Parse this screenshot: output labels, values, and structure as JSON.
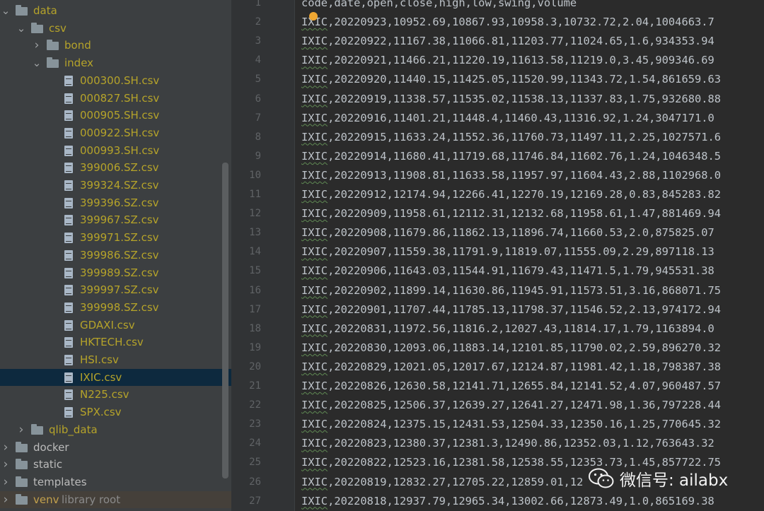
{
  "project_tree": [
    {
      "label": "data",
      "kind": "folder",
      "depth": 0,
      "expanded": true,
      "style": "yellow"
    },
    {
      "label": "csv",
      "kind": "folder",
      "depth": 1,
      "expanded": true,
      "style": "yellow"
    },
    {
      "label": "bond",
      "kind": "folder",
      "depth": 2,
      "expanded": false,
      "style": "yellow"
    },
    {
      "label": "index",
      "kind": "folder",
      "depth": 2,
      "expanded": true,
      "style": "yellow"
    },
    {
      "label": "000300.SH.csv",
      "kind": "file",
      "depth": 3,
      "style": "yellow"
    },
    {
      "label": "000827.SH.csv",
      "kind": "file",
      "depth": 3,
      "style": "yellow"
    },
    {
      "label": "000905.SH.csv",
      "kind": "file",
      "depth": 3,
      "style": "yellow"
    },
    {
      "label": "000922.SH.csv",
      "kind": "file",
      "depth": 3,
      "style": "yellow"
    },
    {
      "label": "000993.SH.csv",
      "kind": "file",
      "depth": 3,
      "style": "yellow"
    },
    {
      "label": "399006.SZ.csv",
      "kind": "file",
      "depth": 3,
      "style": "yellow"
    },
    {
      "label": "399324.SZ.csv",
      "kind": "file",
      "depth": 3,
      "style": "yellow"
    },
    {
      "label": "399396.SZ.csv",
      "kind": "file",
      "depth": 3,
      "style": "yellow"
    },
    {
      "label": "399967.SZ.csv",
      "kind": "file",
      "depth": 3,
      "style": "yellow"
    },
    {
      "label": "399971.SZ.csv",
      "kind": "file",
      "depth": 3,
      "style": "yellow"
    },
    {
      "label": "399986.SZ.csv",
      "kind": "file",
      "depth": 3,
      "style": "yellow"
    },
    {
      "label": "399989.SZ.csv",
      "kind": "file",
      "depth": 3,
      "style": "yellow"
    },
    {
      "label": "399997.SZ.csv",
      "kind": "file",
      "depth": 3,
      "style": "yellow"
    },
    {
      "label": "399998.SZ.csv",
      "kind": "file",
      "depth": 3,
      "style": "yellow"
    },
    {
      "label": "GDAXI.csv",
      "kind": "file",
      "depth": 3,
      "style": "yellow"
    },
    {
      "label": "HKTECH.csv",
      "kind": "file",
      "depth": 3,
      "style": "yellow"
    },
    {
      "label": "HSI.csv",
      "kind": "file",
      "depth": 3,
      "style": "yellow"
    },
    {
      "label": "IXIC.csv",
      "kind": "file",
      "depth": 3,
      "style": "yellow",
      "selected": true
    },
    {
      "label": "N225.csv",
      "kind": "file",
      "depth": 3,
      "style": "yellow"
    },
    {
      "label": "SPX.csv",
      "kind": "file",
      "depth": 3,
      "style": "yellow"
    },
    {
      "label": "qlib_data",
      "kind": "folder",
      "depth": 1,
      "expanded": false,
      "style": "yellow"
    },
    {
      "label": "docker",
      "kind": "folder",
      "depth": 0,
      "expanded": false,
      "style": "normal"
    },
    {
      "label": "static",
      "kind": "folder",
      "depth": 0,
      "expanded": false,
      "style": "normal"
    },
    {
      "label": "templates",
      "kind": "folder",
      "depth": 0,
      "expanded": false,
      "style": "normal"
    },
    {
      "label": "venv",
      "kind": "folder",
      "depth": 0,
      "expanded": false,
      "style": "venv",
      "suffix": "library root"
    }
  ],
  "editor": {
    "line_numbers": [
      "1",
      "2",
      "3",
      "4",
      "5",
      "6",
      "7",
      "8",
      "9",
      "10",
      "11",
      "12",
      "13",
      "14",
      "15",
      "16",
      "17",
      "18",
      "19",
      "20",
      "21",
      "22",
      "23",
      "24",
      "25",
      "26",
      "27"
    ],
    "lines": [
      "code,date,open,close,high,low,swing,volume",
      "IXIC,20220923,10952.69,10867.93,10958.3,10732.72,2.04,1004663.7",
      "IXIC,20220922,11167.38,11066.81,11203.77,11024.65,1.6,934353.94",
      "IXIC,20220921,11466.21,11220.19,11613.58,11219.0,3.45,909346.69",
      "IXIC,20220920,11440.15,11425.05,11520.99,11343.72,1.54,861659.63",
      "IXIC,20220919,11338.57,11535.02,11538.13,11337.83,1.75,932680.88",
      "IXIC,20220916,11401.21,11448.4,11460.43,11316.92,1.24,3047171.0",
      "IXIC,20220915,11633.24,11552.36,11760.73,11497.11,2.25,1027571.6",
      "IXIC,20220914,11680.41,11719.68,11746.84,11602.76,1.24,1046348.5",
      "IXIC,20220913,11908.81,11633.58,11957.97,11604.43,2.88,1102968.0",
      "IXIC,20220912,12174.94,12266.41,12270.19,12169.28,0.83,845283.82",
      "IXIC,20220909,11958.61,12112.31,12132.68,11958.61,1.47,881469.94",
      "IXIC,20220908,11679.86,11862.13,11896.74,11660.53,2.0,875825.07",
      "IXIC,20220907,11559.38,11791.9,11819.07,11555.09,2.29,897118.13",
      "IXIC,20220906,11643.03,11544.91,11679.43,11471.5,1.79,945531.38",
      "IXIC,20220902,11899.14,11630.86,11945.91,11573.51,3.16,868071.75",
      "IXIC,20220901,11707.44,11785.13,11798.37,11546.52,2.13,974172.94",
      "IXIC,20220831,11972.56,11816.2,12027.43,11814.17,1.79,1163894.0",
      "IXIC,20220830,12093.06,11883.14,12101.85,11790.02,2.59,896270.32",
      "IXIC,20220829,12021.05,12017.67,12124.87,11981.42,1.18,798387.38",
      "IXIC,20220826,12630.58,12141.71,12655.84,12141.52,4.07,960487.57",
      "IXIC,20220825,12506.37,12639.27,12641.27,12471.98,1.36,797228.44",
      "IXIC,20220824,12375.15,12431.53,12504.33,12350.16,1.25,770645.32",
      "IXIC,20220823,12380.37,12381.3,12490.86,12352.03,1.12,763643.32",
      "IXIC,20220822,12523.16,12381.58,12538.55,12353.73,1.45,857722.75",
      "IXIC,20220819,12832.27,12705.22,12859.01,12",
      "IXIC,20220818,12937.79,12965.34,13002.66,12873.49,1.0,865169.38"
    ]
  },
  "watermark": {
    "text": "微信号: ailabx",
    "icon": "wechat-icon"
  },
  "colors": {
    "accent_folder": "#b5a32a",
    "selection": "#0d293e",
    "bulb": "#f0a732"
  }
}
